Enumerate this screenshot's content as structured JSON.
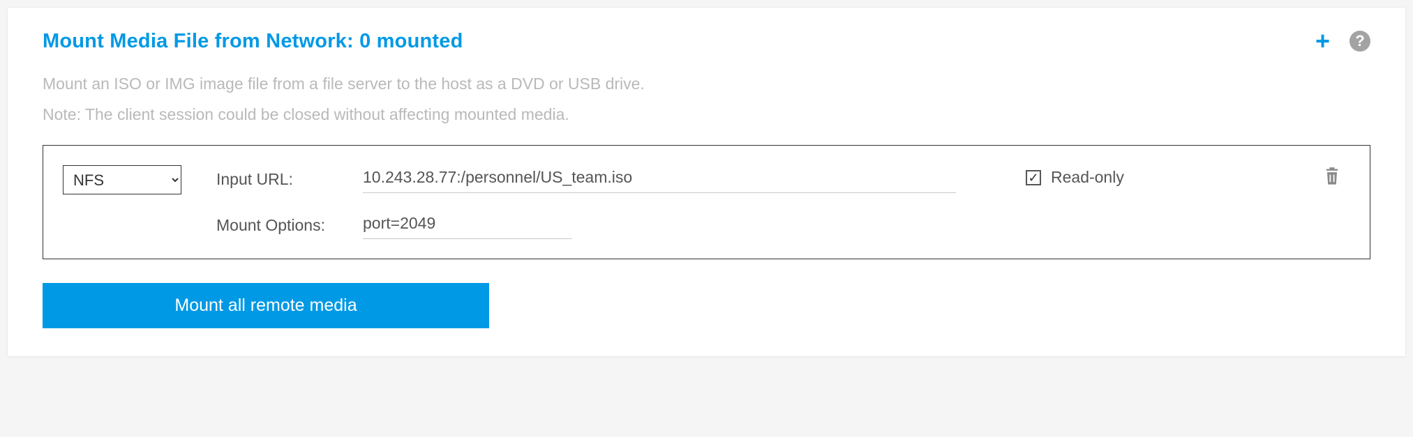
{
  "header": {
    "title": "Mount Media File from Network: 0 mounted"
  },
  "description": {
    "line1": "Mount an ISO or IMG image file from a file server to the host as a DVD or USB drive.",
    "line2": "Note: The client session could be closed without affecting mounted media."
  },
  "row": {
    "protocol_selected": "NFS",
    "url_label": "Input URL:",
    "url_value": "10.243.28.77:/personnel/US_team.iso",
    "options_label": "Mount Options:",
    "options_value": "port=2049",
    "readonly_label": "Read-only",
    "readonly_checked": true
  },
  "actions": {
    "mount_all_label": "Mount all remote media"
  },
  "icons": {
    "add": "+",
    "help": "?",
    "check": "✓"
  }
}
